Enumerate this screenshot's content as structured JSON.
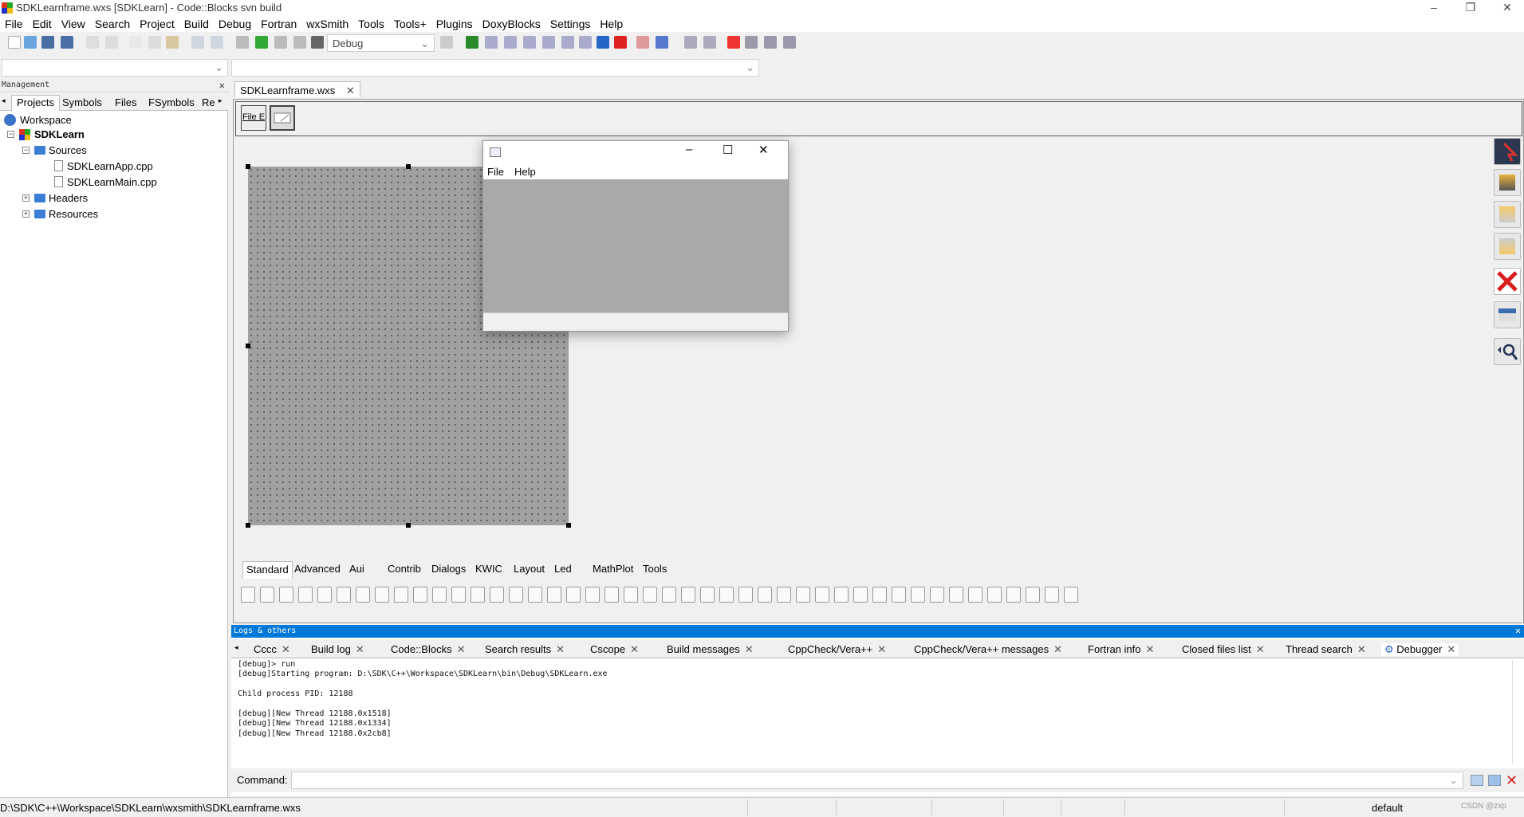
{
  "window": {
    "title": "SDKLearnframe.wxs [SDKLearn] - Code::Blocks svn build",
    "minimize": "–",
    "restore": "❐",
    "close": "✕"
  },
  "menu": [
    "File",
    "Edit",
    "View",
    "Search",
    "Project",
    "Build",
    "Debug",
    "Fortran",
    "wxSmith",
    "Tools",
    "Tools+",
    "Plugins",
    "DoxyBlocks",
    "Settings",
    "Help"
  ],
  "toolbar": {
    "build_target": "Debug"
  },
  "management": {
    "title": "Management",
    "tabs": [
      "Projects",
      "Symbols",
      "Files",
      "FSymbols",
      "Re"
    ],
    "tree": {
      "workspace": "Workspace",
      "project": "SDKLearn",
      "sources": "Sources",
      "files": [
        "SDKLearnApp.cpp",
        "SDKLearnMain.cpp"
      ],
      "headers": "Headers",
      "resources": "Resources"
    }
  },
  "editor": {
    "tab": "SDKLearnframe.wxs",
    "strip_label": "File E"
  },
  "preview": {
    "menu": [
      "File",
      "Help"
    ],
    "minimize": "–",
    "maximize": "☐",
    "close": "✕"
  },
  "palette": {
    "tabs": [
      "Standard",
      "Advanced",
      "Aui",
      "Contrib",
      "Dialogs",
      "KWIC",
      "Layout",
      "Led",
      "MathPlot",
      "Tools"
    ]
  },
  "logs": {
    "title": "Logs & others",
    "tabs": [
      "Cccc",
      "Build log",
      "Code::Blocks",
      "Search results",
      "Cscope",
      "Build messages",
      "CppCheck/Vera++",
      "CppCheck/Vera++ messages",
      "Fortran info",
      "Closed files list",
      "Thread search",
      "Debugger"
    ],
    "lines": "[debug]> run\n[debug]Starting program: D:\\SDK\\C++\\Workspace\\SDKLearn\\bin\\Debug\\SDKLearn.exe\n\nChild process PID: 12188\n\n[debug][New Thread 12188.0x1518]\n[debug][New Thread 12188.0x1334]\n[debug][New Thread 12188.0x2cb8]",
    "command_label": "Command:"
  },
  "status": {
    "path": "D:\\SDK\\C++\\Workspace\\SDKLearn\\wxsmith\\SDKLearnframe.wxs",
    "mode": "default",
    "watermark": "CSDN @zxp"
  },
  "colors": {
    "accent": "#0078d7",
    "canvas": "#a0a0a0",
    "close_red": "#d81e1e"
  }
}
